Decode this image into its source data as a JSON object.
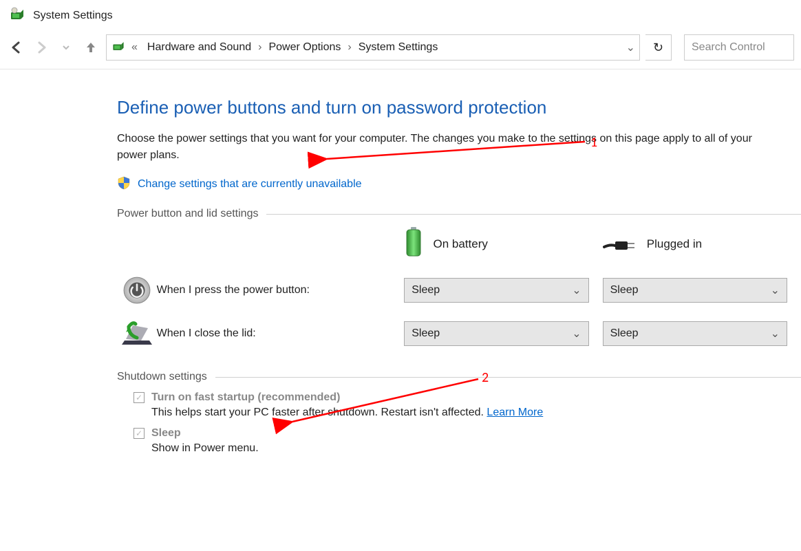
{
  "titlebar": {
    "title": "System Settings"
  },
  "breadcrumbs": {
    "b0": "Hardware and Sound",
    "b1": "Power Options",
    "b2": "System Settings"
  },
  "search": {
    "placeholder": "Search Control"
  },
  "page": {
    "heading": "Define power buttons and turn on password protection",
    "subtitle": "Choose the power settings that you want for your computer. The changes you make to the settings on this page apply to all of your power plans.",
    "admin_link": "Change settings that are currently unavailable"
  },
  "sections": {
    "pbls_title": "Power button and lid settings",
    "col_battery": "On battery",
    "col_plugged": "Plugged in",
    "row_power_button": "When I press the power button:",
    "row_lid": "When I close the lid:",
    "val_power_battery": "Sleep",
    "val_power_plugged": "Sleep",
    "val_lid_battery": "Sleep",
    "val_lid_plugged": "Sleep",
    "shutdown_title": "Shutdown settings",
    "fast_startup_label": "Turn on fast startup (recommended)",
    "fast_startup_desc": "This helps start your PC faster after shutdown. Restart isn't affected. ",
    "learn_more": "Learn More",
    "sleep_label": "Sleep",
    "sleep_desc": "Show in Power menu."
  },
  "annotations": {
    "a1": "1",
    "a2": "2"
  }
}
